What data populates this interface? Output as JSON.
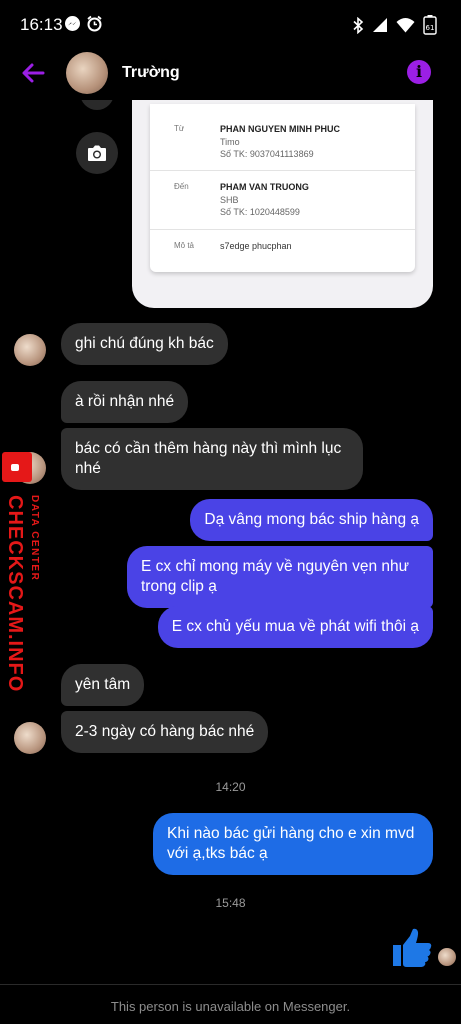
{
  "status_bar": {
    "time": "16:13",
    "battery": "61"
  },
  "header": {
    "contact_name": "Trường"
  },
  "receipt": {
    "from_label": "Từ",
    "from_name": "PHAN NGUYEN MINH PHUC",
    "from_bank": "Timo",
    "from_account": "Số TK: 9037041113869",
    "to_label": "Đến",
    "to_name": "PHAM VAN TRUONG",
    "to_bank": "SHB",
    "to_account": "Số TK: 1020448599",
    "desc_label": "Mô tả",
    "desc_value": "s7edge phucphan"
  },
  "messages": [
    {
      "side": "in",
      "text": "ghi chú đúng kh bác"
    },
    {
      "side": "in",
      "text": "à rồi nhận nhé"
    },
    {
      "side": "in",
      "text": "bác có cần thêm hàng này thì mình lục nhé"
    },
    {
      "side": "out",
      "text": "Dạ vâng mong bác ship hàng ạ"
    },
    {
      "side": "out",
      "text": "E cx chỉ mong máy về nguyên vẹn như trong clip ạ"
    },
    {
      "side": "out",
      "text": "E cx chủ yếu mua về phát wifi thôi ạ"
    },
    {
      "side": "in",
      "text": "yên tâm"
    },
    {
      "side": "in",
      "text": "2-3 ngày có hàng bác nhé"
    },
    {
      "side": "out",
      "text": "Khi nào bác gửi hàng cho e xin mvd với ạ,tks bác ạ"
    }
  ],
  "timestamps": [
    "14:20",
    "15:48"
  ],
  "watermark": {
    "main": "CHECKSCAM.INFO",
    "sub": "DATA CENTER"
  },
  "footer": {
    "text": "This person is unavailable on Messenger."
  },
  "colors": {
    "accent": "#9b1fe5",
    "bubble_out": "#4a43e6",
    "bubble_out_last": "#1e6ce6",
    "bubble_in": "#303030",
    "watermark": "#e51818"
  }
}
